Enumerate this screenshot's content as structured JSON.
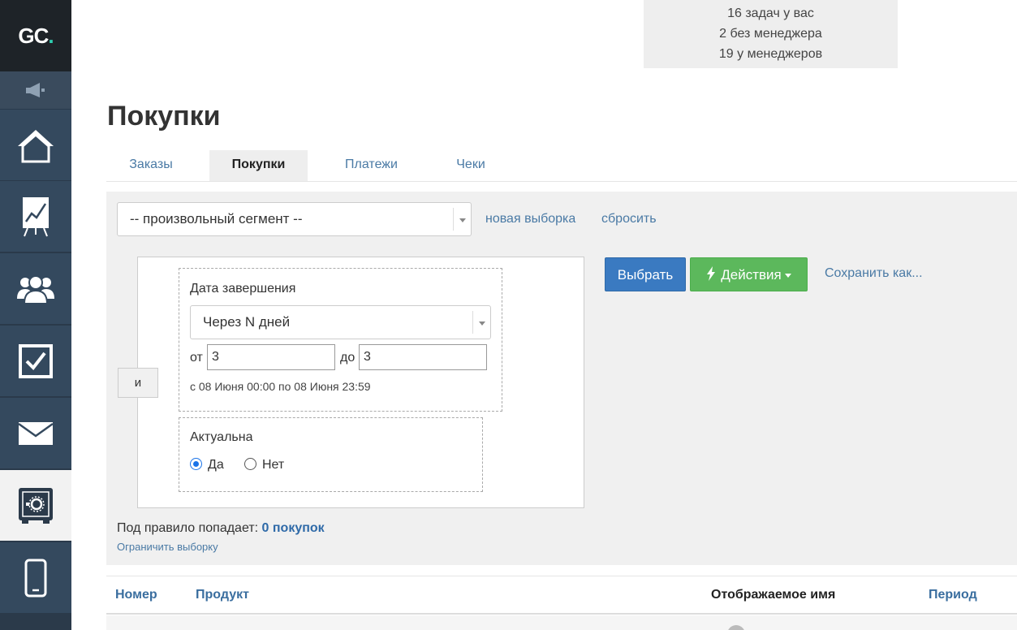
{
  "logo": {
    "text": "GC",
    "dot": "."
  },
  "sidebar": {
    "items": [
      {
        "name": "home-icon"
      },
      {
        "name": "chart-icon"
      },
      {
        "name": "users-icon"
      },
      {
        "name": "tasks-icon"
      },
      {
        "name": "mail-icon"
      },
      {
        "name": "safe-icon",
        "active": true
      },
      {
        "name": "mobile-icon"
      }
    ]
  },
  "tasks": {
    "line1": "16 задач у вас",
    "line2": "2 без менеджера",
    "line3": "19 у менеджеров"
  },
  "page_title": "Покупки",
  "tabs": [
    {
      "label": "Заказы"
    },
    {
      "label": "Покупки",
      "active": true
    },
    {
      "label": "Платежи"
    },
    {
      "label": "Чеки"
    }
  ],
  "segment": {
    "value": "-- произвольный сегмент --",
    "new_label": "новая выборка",
    "reset_label": "сбросить"
  },
  "rule": {
    "and_label": "и",
    "date_label": "Дата завершения",
    "mode_value": "Через N дней",
    "from_label": "от",
    "from_value": "3",
    "to_label": "до",
    "to_value": "3",
    "range_text": "с 08 Июня 00:00 по 08 Июня 23:59",
    "actual_label": "Актуальна",
    "yes_label": "Да",
    "no_label": "Нет"
  },
  "actions": {
    "select_label": "Выбрать",
    "actions_label": "Действия",
    "save_as_label": "Сохранить как..."
  },
  "result": {
    "prefix": "Под правило попадает:",
    "count": "0 покупок",
    "limit_label": "Ограничить выборку"
  },
  "table": {
    "columns": [
      "Номер",
      "Продукт",
      "Отображаемое имя",
      "Период"
    ]
  },
  "colors": {
    "sidebar": "#34495e",
    "logo_accent": "#2fd0b2",
    "primary": "#3a7ac1",
    "success": "#5cb85c",
    "link": "#4a7aa5"
  }
}
